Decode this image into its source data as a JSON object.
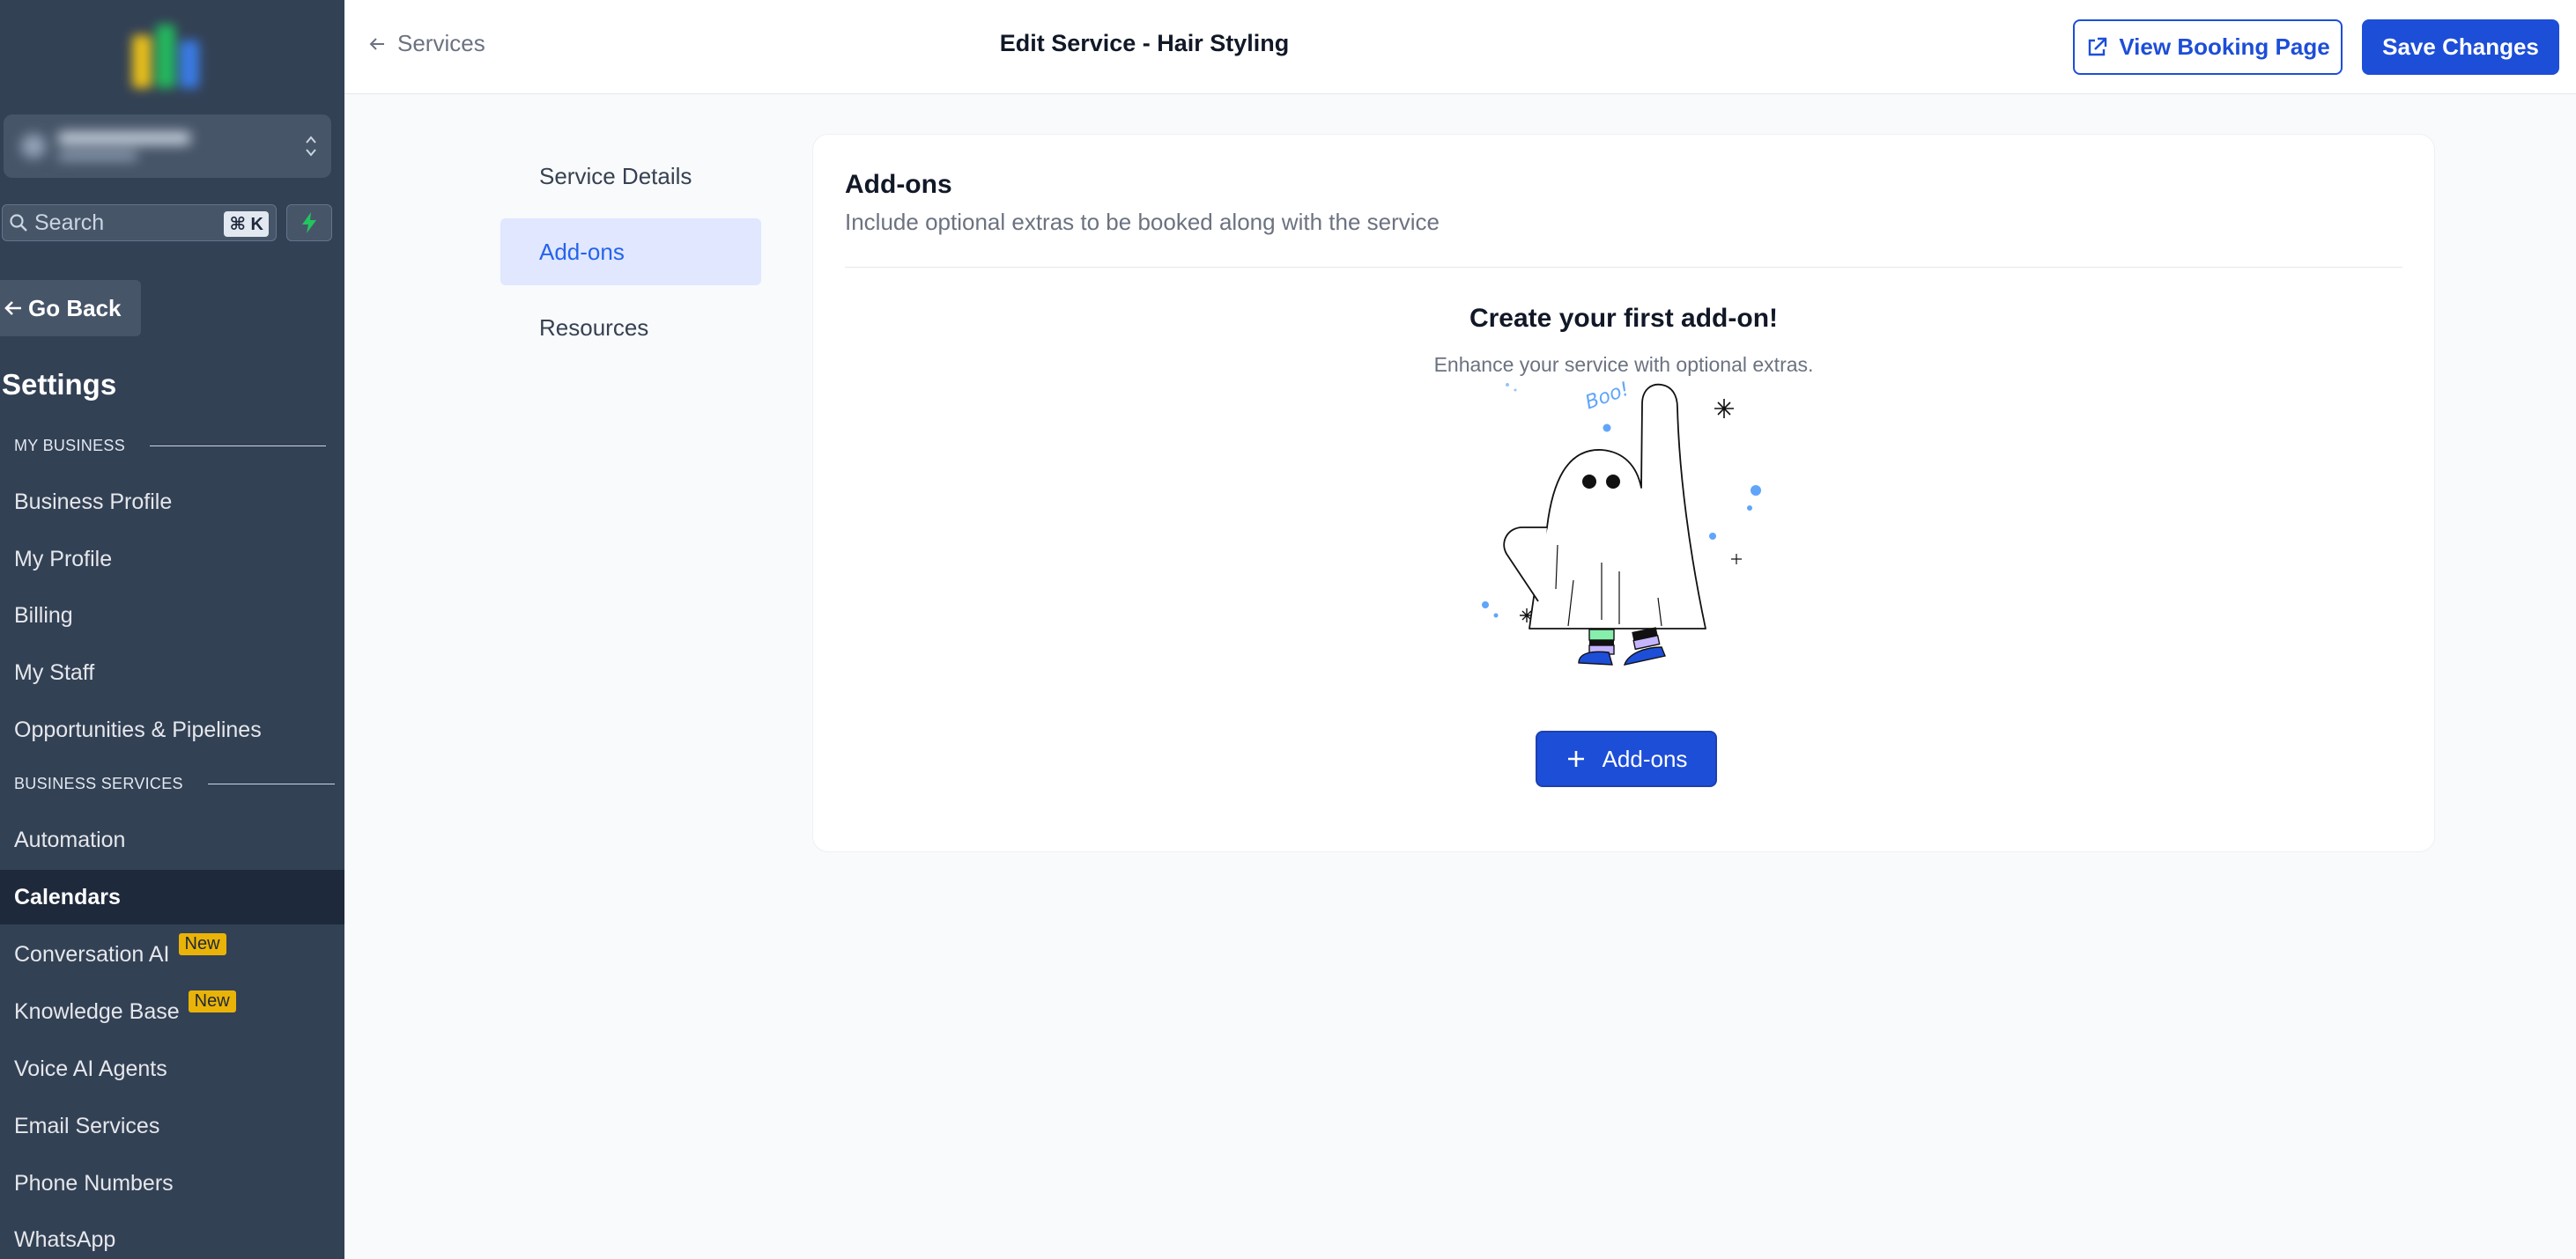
{
  "sidebar": {
    "search_placeholder": "Search",
    "search_shortcut": "⌘ K",
    "go_back_label": "Go Back",
    "settings_title": "Settings",
    "sections": {
      "my_business": "MY BUSINESS",
      "business_services": "BUSINESS SERVICES"
    },
    "my_business_items": [
      "Business Profile",
      "My Profile",
      "Billing",
      "My Staff",
      "Opportunities & Pipelines"
    ],
    "business_services_items": [
      {
        "label": "Automation",
        "badge": ""
      },
      {
        "label": "Calendars",
        "badge": "",
        "active": true
      },
      {
        "label": "Conversation AI",
        "badge": "New"
      },
      {
        "label": "Knowledge Base",
        "badge": "New"
      },
      {
        "label": "Voice AI Agents",
        "badge": ""
      },
      {
        "label": "Email Services",
        "badge": ""
      },
      {
        "label": "Phone Numbers",
        "badge": ""
      },
      {
        "label": "WhatsApp",
        "badge": ""
      }
    ]
  },
  "header": {
    "back_label": "Services",
    "title": "Edit Service - Hair Styling",
    "view_booking_label": "View Booking Page",
    "save_label": "Save Changes"
  },
  "subnav": {
    "items": [
      "Service Details",
      "Add-ons",
      "Resources"
    ],
    "active": "Add-ons"
  },
  "addons": {
    "title": "Add-ons",
    "subtitle": "Include optional extras to be booked along with the service",
    "empty_title": "Create your first add-on!",
    "empty_subtitle": "Enhance your service with optional extras.",
    "illustration_text": "Boo!",
    "add_button_label": "Add-ons"
  },
  "colors": {
    "sidebar_bg": "#334155",
    "sidebar_active": "#1e293b",
    "primary": "#1d4ed8",
    "badge": "#eab308",
    "subnav_active_bg": "#e0e7ff"
  }
}
